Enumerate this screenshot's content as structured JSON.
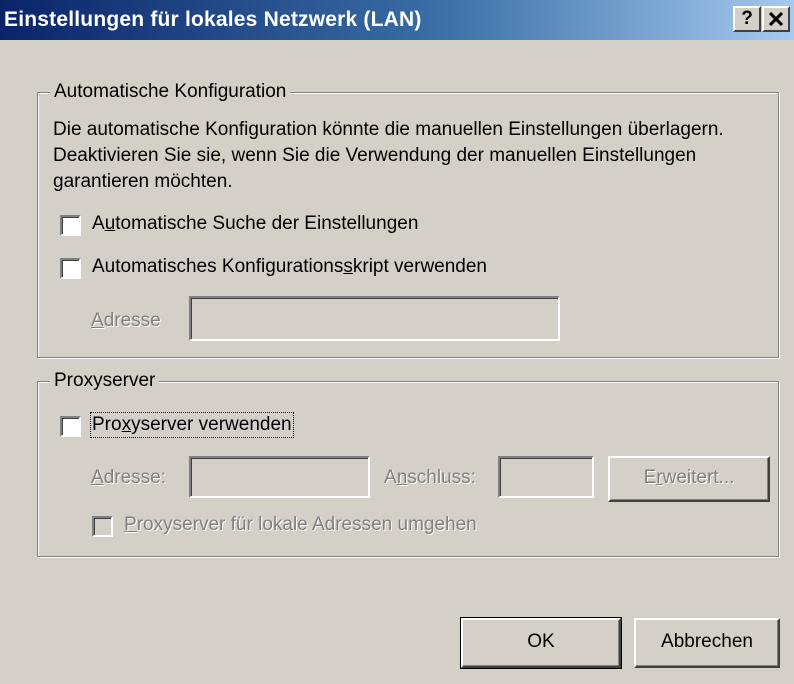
{
  "window": {
    "title": "Einstellungen für lokales Netzwerk (LAN)",
    "help_button": "?",
    "close_button": "✕"
  },
  "auto_config": {
    "legend": "Automatische Konfiguration",
    "description": "Die automatische Konfiguration könnte die manuellen Einstellungen überlagern. Deaktivieren Sie sie, wenn Sie die Verwendung der manuellen Einstellungen garantieren möchten.",
    "auto_detect": {
      "label": "Automatische Suche der Einstellungen",
      "checked": false
    },
    "auto_script": {
      "label": "Automatisches Konfigurationsskript verwenden",
      "checked": false
    },
    "address_label": "Adresse",
    "address_value": ""
  },
  "proxy": {
    "legend": "Proxyserver",
    "use_proxy": {
      "label": "Proxyserver verwenden",
      "checked": false
    },
    "address_label": "Adresse:",
    "address_value": "",
    "port_label": "Anschluss:",
    "port_value": "",
    "advanced_button": "Erweitert...",
    "bypass_local": {
      "label": "Proxyserver für lokale Adressen umgehen",
      "checked": false
    }
  },
  "buttons": {
    "ok": "OK",
    "cancel": "Abbrechen"
  },
  "colors": {
    "dialog_bg": "#d4d0c8",
    "title_start": "#0a246a",
    "title_end": "#a6caf0",
    "disabled_text": "#808080"
  }
}
